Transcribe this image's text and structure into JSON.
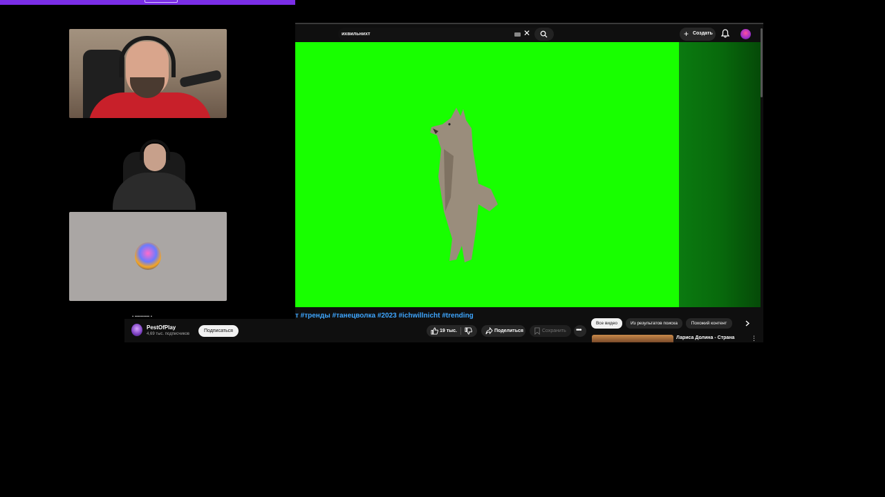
{
  "search": {
    "query": "ихвильнихт"
  },
  "header": {
    "create_label": "Создать"
  },
  "video": {
    "tags_line": "т #тренды #танецволка #2023 #ichwillnicht #trending"
  },
  "channel": {
    "name": "PestOfPlay",
    "subscribers": "4,69 тыс. подписчиков",
    "subscribe_label": "Подписаться"
  },
  "actions": {
    "like_count": "19 тыс.",
    "share_label": "Поделиться",
    "save_label": "Сохранить"
  },
  "chips": [
    "Все видео",
    "Из результатов поиска",
    "Похожий контент"
  ],
  "recommendation": {
    "title": "Лариса Долина - Страна"
  },
  "colors": {
    "chroma_green": "#18ff00",
    "banner_purple": "#7a2ee6",
    "link_blue": "#3ea6ff",
    "shirt_red": "#c8202a"
  }
}
